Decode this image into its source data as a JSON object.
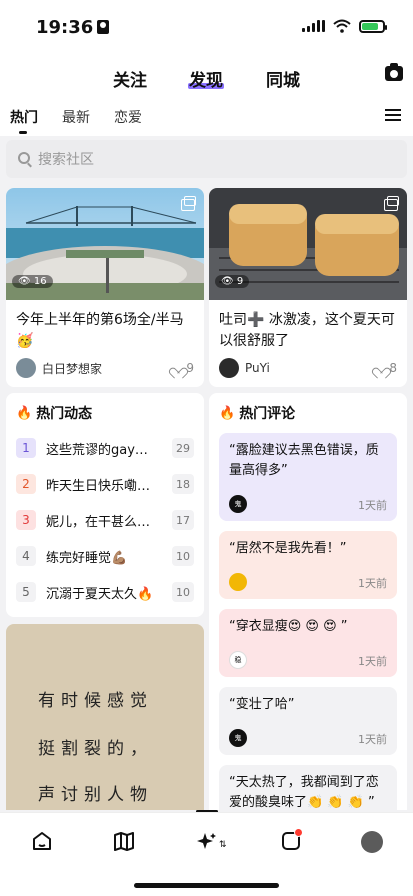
{
  "status": {
    "time": "19:36"
  },
  "top_tabs": [
    "关注",
    "发现",
    "同城"
  ],
  "sub_tabs": [
    "热门",
    "最新",
    "恋爱"
  ],
  "search": {
    "placeholder": "搜索社区"
  },
  "posts": [
    {
      "title": "今年上半年的第6场全/半马🥳",
      "author": "白日梦想家",
      "likes": "9",
      "views": "16"
    },
    {
      "title": "吐司➕ 冰激凌，这个夏天可以很舒服了",
      "author": "PuYi",
      "likes": "8",
      "views": "9"
    }
  ],
  "hot_posts": {
    "title": "热门动态",
    "items": [
      {
        "rank": "1",
        "text": "这些荒谬的gay…",
        "count": "29"
      },
      {
        "rank": "2",
        "text": "昨天生日快乐嘞…",
        "count": "18"
      },
      {
        "rank": "3",
        "text": "妮儿，在干甚么…",
        "count": "17"
      },
      {
        "rank": "4",
        "text": "练完好睡觉💪🏽",
        "count": "10"
      },
      {
        "rank": "5",
        "text": "沉溺于夏天太久🔥",
        "count": "10"
      }
    ]
  },
  "hot_comments": {
    "title": "热门评论",
    "items": [
      {
        "text": "“露脸建议去黑色错误，质量高得多”",
        "time": "1天前",
        "avatar_text": "鬼"
      },
      {
        "text": "“居然不是我先看！”",
        "time": "1天前",
        "avatar_text": ""
      },
      {
        "text": "“穿衣显瘦😍 😍 😍 ”",
        "time": "1天前",
        "avatar_text": "稳"
      },
      {
        "text": "“变壮了哈”",
        "time": "1天前",
        "avatar_text": "鬼"
      },
      {
        "text": "“天太热了，我都闻到了恋爱的酸臭味了👏 👏 👏 ”",
        "time": "",
        "avatar_text": ""
      }
    ]
  },
  "poster_lines": [
    "有时候感觉",
    "挺割裂的，",
    "声讨别人物"
  ],
  "colors": {
    "accent": "#7b61ff",
    "fire": "#ff5a1f"
  }
}
